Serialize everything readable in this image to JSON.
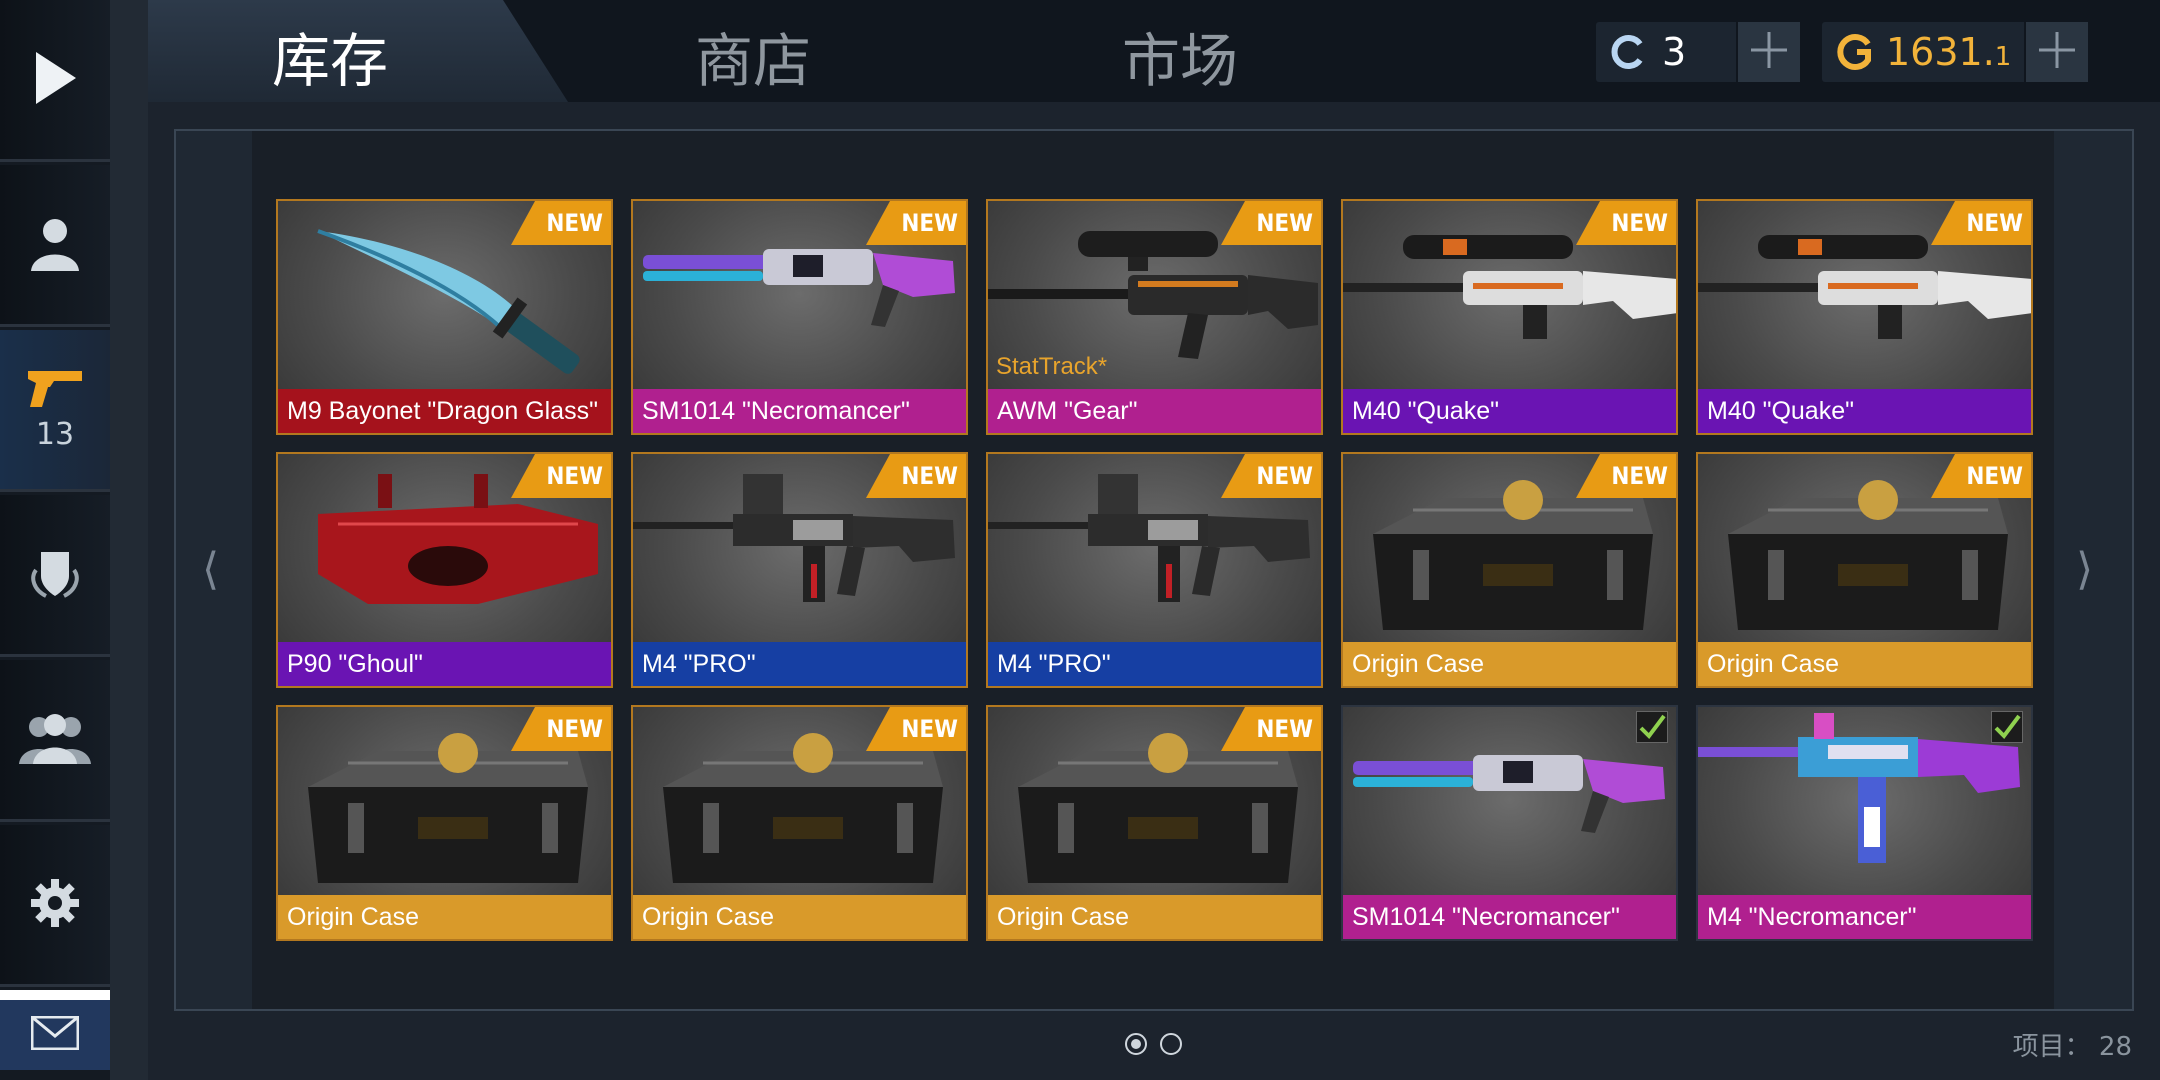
{
  "tabs": [
    {
      "label": "库存",
      "active": true
    },
    {
      "label": "商店",
      "active": false
    },
    {
      "label": "市场",
      "active": false
    }
  ],
  "currency": {
    "credits": {
      "icon": "c-coin-icon",
      "value": "3"
    },
    "gold": {
      "icon": "g-coin-icon",
      "value_main": "1631.",
      "value_small": "1"
    }
  },
  "sidebar": {
    "items": [
      {
        "name": "play",
        "icon": "play-icon"
      },
      {
        "name": "profile",
        "icon": "user-icon"
      },
      {
        "name": "inventory",
        "icon": "pistol-icon",
        "count": "13",
        "active": true
      },
      {
        "name": "clan",
        "icon": "shield-icon"
      },
      {
        "name": "friends",
        "icon": "group-icon"
      },
      {
        "name": "settings",
        "icon": "gear-icon"
      },
      {
        "name": "mail",
        "icon": "mail-icon"
      }
    ]
  },
  "inventory": {
    "items": [
      {
        "label": "M9 Bayonet \"Dragon Glass\"",
        "rarity_color": "#a5121c",
        "badge": "NEW",
        "art": "knife"
      },
      {
        "label": "SM1014 \"Necromancer\"",
        "rarity_color": "#b0208f",
        "badge": "NEW",
        "art": "shotgun"
      },
      {
        "label": "AWM \"Gear\"",
        "rarity_color": "#b0208f",
        "badge": "NEW",
        "art": "awm",
        "stattrack": "StatTrack*"
      },
      {
        "label": "M40 \"Quake\"",
        "rarity_color": "#6a14b3",
        "badge": "NEW",
        "art": "sniper"
      },
      {
        "label": "M40 \"Quake\"",
        "rarity_color": "#6a14b3",
        "badge": "NEW",
        "art": "sniper"
      },
      {
        "label": "P90 \"Ghoul\"",
        "rarity_color": "#6a14b3",
        "badge": "NEW",
        "art": "p90"
      },
      {
        "label": "M4 \"PRO\"",
        "rarity_color": "#163fa3",
        "badge": "NEW",
        "art": "rifle"
      },
      {
        "label": "M4 \"PRO\"",
        "rarity_color": "#163fa3",
        "badge": "NEW",
        "art": "rifle"
      },
      {
        "label": "Origin Case",
        "rarity_color": "#d99a2a",
        "badge": "NEW",
        "art": "case"
      },
      {
        "label": "Origin Case",
        "rarity_color": "#d99a2a",
        "badge": "NEW",
        "art": "case"
      },
      {
        "label": "Origin Case",
        "rarity_color": "#d99a2a",
        "badge": "NEW",
        "art": "case"
      },
      {
        "label": "Origin Case",
        "rarity_color": "#d99a2a",
        "badge": "NEW",
        "art": "case"
      },
      {
        "label": "Origin Case",
        "rarity_color": "#d99a2a",
        "badge": "NEW",
        "art": "case"
      },
      {
        "label": "SM1014 \"Necromancer\"",
        "rarity_color": "#b0208f",
        "badge": "",
        "equipped": true,
        "art": "shotgun"
      },
      {
        "label": "M4 \"Necromancer\"",
        "rarity_color": "#b0208f",
        "badge": "",
        "equipped": true,
        "art": "rifle-neon"
      }
    ]
  },
  "pagination": {
    "pages": 2,
    "current": 1
  },
  "footer": {
    "items_count": "项目： 28"
  }
}
